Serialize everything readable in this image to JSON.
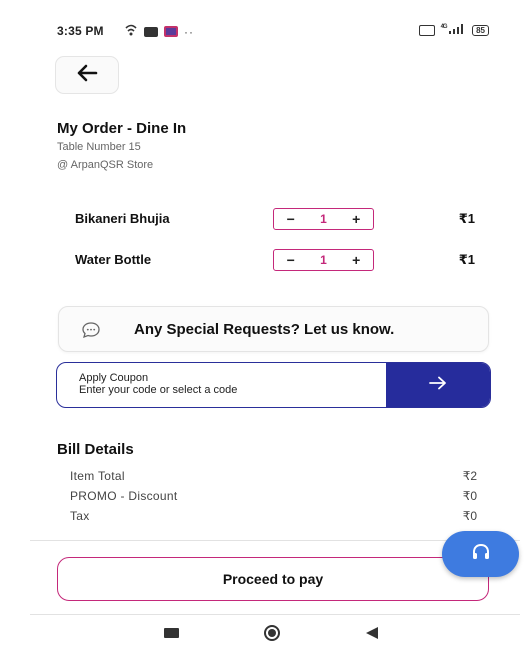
{
  "status_bar": {
    "time": "3:35 PM",
    "left_icons": [
      "wifi-calling-icon",
      "media-icon",
      "photo-icon"
    ],
    "overflow": "··",
    "signal_label": "4G",
    "battery": "85"
  },
  "header": {
    "back_icon": "arrow-left-icon",
    "title": "My Order - Dine In",
    "table_number": "Table Number 15",
    "store": "@ ArpanQSR Store"
  },
  "items": [
    {
      "name": "Bikaneri Bhujia",
      "quantity": "1",
      "price": "₹1",
      "minus": "−",
      "plus": "+"
    },
    {
      "name": "Water Bottle",
      "quantity": "1",
      "price": "₹1",
      "minus": "−",
      "plus": "+"
    }
  ],
  "special_request": {
    "icon": "chat-bubble-icon",
    "text": "Any Special Requests? Let us know."
  },
  "coupon": {
    "label": "Apply Coupon",
    "placeholder": "Enter your code or select a code",
    "button_icon": "arrow-right-icon"
  },
  "bill": {
    "title": "Bill Details",
    "rows": [
      {
        "label": "Item Total",
        "value": "₹2"
      },
      {
        "label": "PROMO - Discount",
        "value": "₹0"
      },
      {
        "label": "Tax",
        "value": "₹0"
      }
    ]
  },
  "footer": {
    "proceed_label": "Proceed to pay",
    "support_icon": "headset-icon"
  },
  "colors": {
    "accent_pink": "#c4287a",
    "coupon_blue": "#262c9c",
    "fab_blue": "#3e7be0"
  }
}
